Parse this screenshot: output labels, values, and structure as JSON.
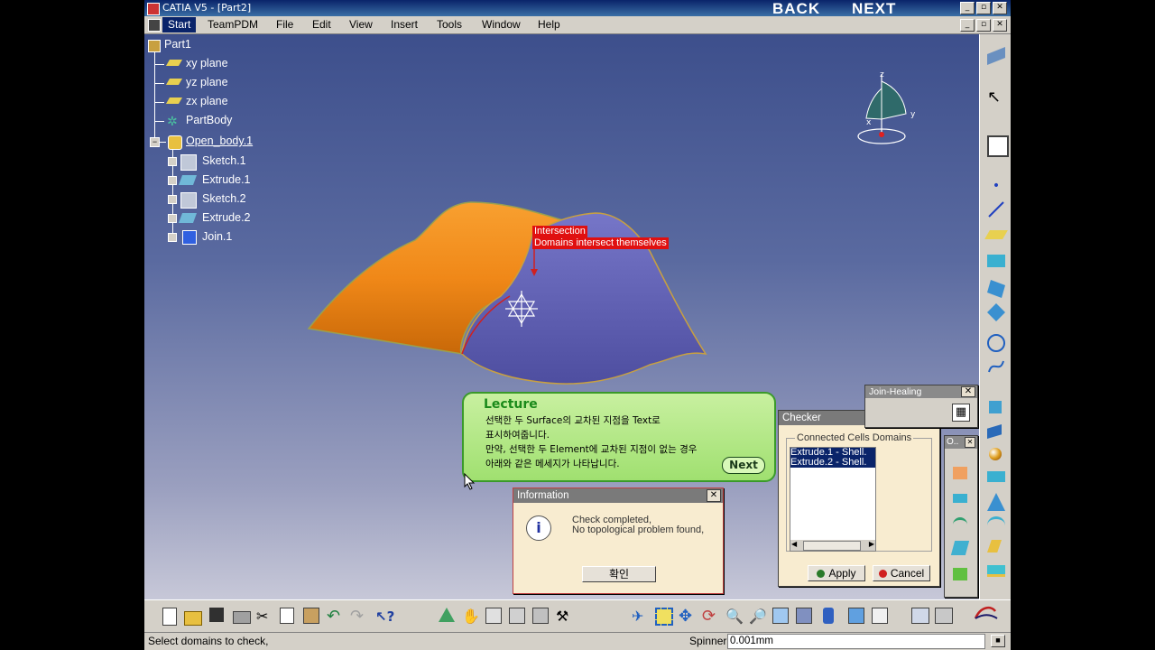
{
  "window": {
    "title": "CATIA V5 - [Part2]"
  },
  "nav": {
    "back": "BACK",
    "next": "NEXT"
  },
  "menu": [
    "Start",
    "TeamPDM",
    "File",
    "Edit",
    "View",
    "Insert",
    "Tools",
    "Window",
    "Help"
  ],
  "tree": {
    "root": "Part1",
    "planes": [
      "xy plane",
      "yz plane",
      "zx plane"
    ],
    "partbody": "PartBody",
    "openbody": "Open_body.1",
    "children": [
      "Sketch.1",
      "Extrude.1",
      "Sketch.2",
      "Extrude.2",
      "Join.1"
    ]
  },
  "annotation": {
    "line1": "Intersection",
    "line2": "Domains intersect themselves"
  },
  "compass": {
    "z": "z",
    "y": "y",
    "x": "x"
  },
  "lecture": {
    "title": "Lecture",
    "lines": [
      "선택한 두 Surface의 교차된 지점을 Text로",
      "표시하여줍니다.",
      "만약, 선택한 두 Element에 교차된 지점이 없는 경우",
      "아래와 같은 메세지가 나타납니다."
    ],
    "next": "Next"
  },
  "information": {
    "title": "Information",
    "line1": "Check completed,",
    "line2": "No topological problem found,",
    "ok": "확인"
  },
  "checker": {
    "title": "Checker",
    "group": "Connected Cells Domains",
    "items": [
      "Extrude.1 - Shell.",
      "Extrude.2 - Shell."
    ],
    "apply": "Apply",
    "cancel": "Cancel"
  },
  "joinhealing": {
    "title": "Join-Healing"
  },
  "mini": {
    "title": "O.."
  },
  "status": {
    "text": "Select domains to check,",
    "spinner_label": "Spinner",
    "spinner_value": "0.001mm"
  },
  "colors": {
    "orange": "#f08a18",
    "purple": "#6a6ab8",
    "bg_top": "#3d4f8c",
    "lecture_green": "#a0e070",
    "red_tag": "#e01010"
  }
}
